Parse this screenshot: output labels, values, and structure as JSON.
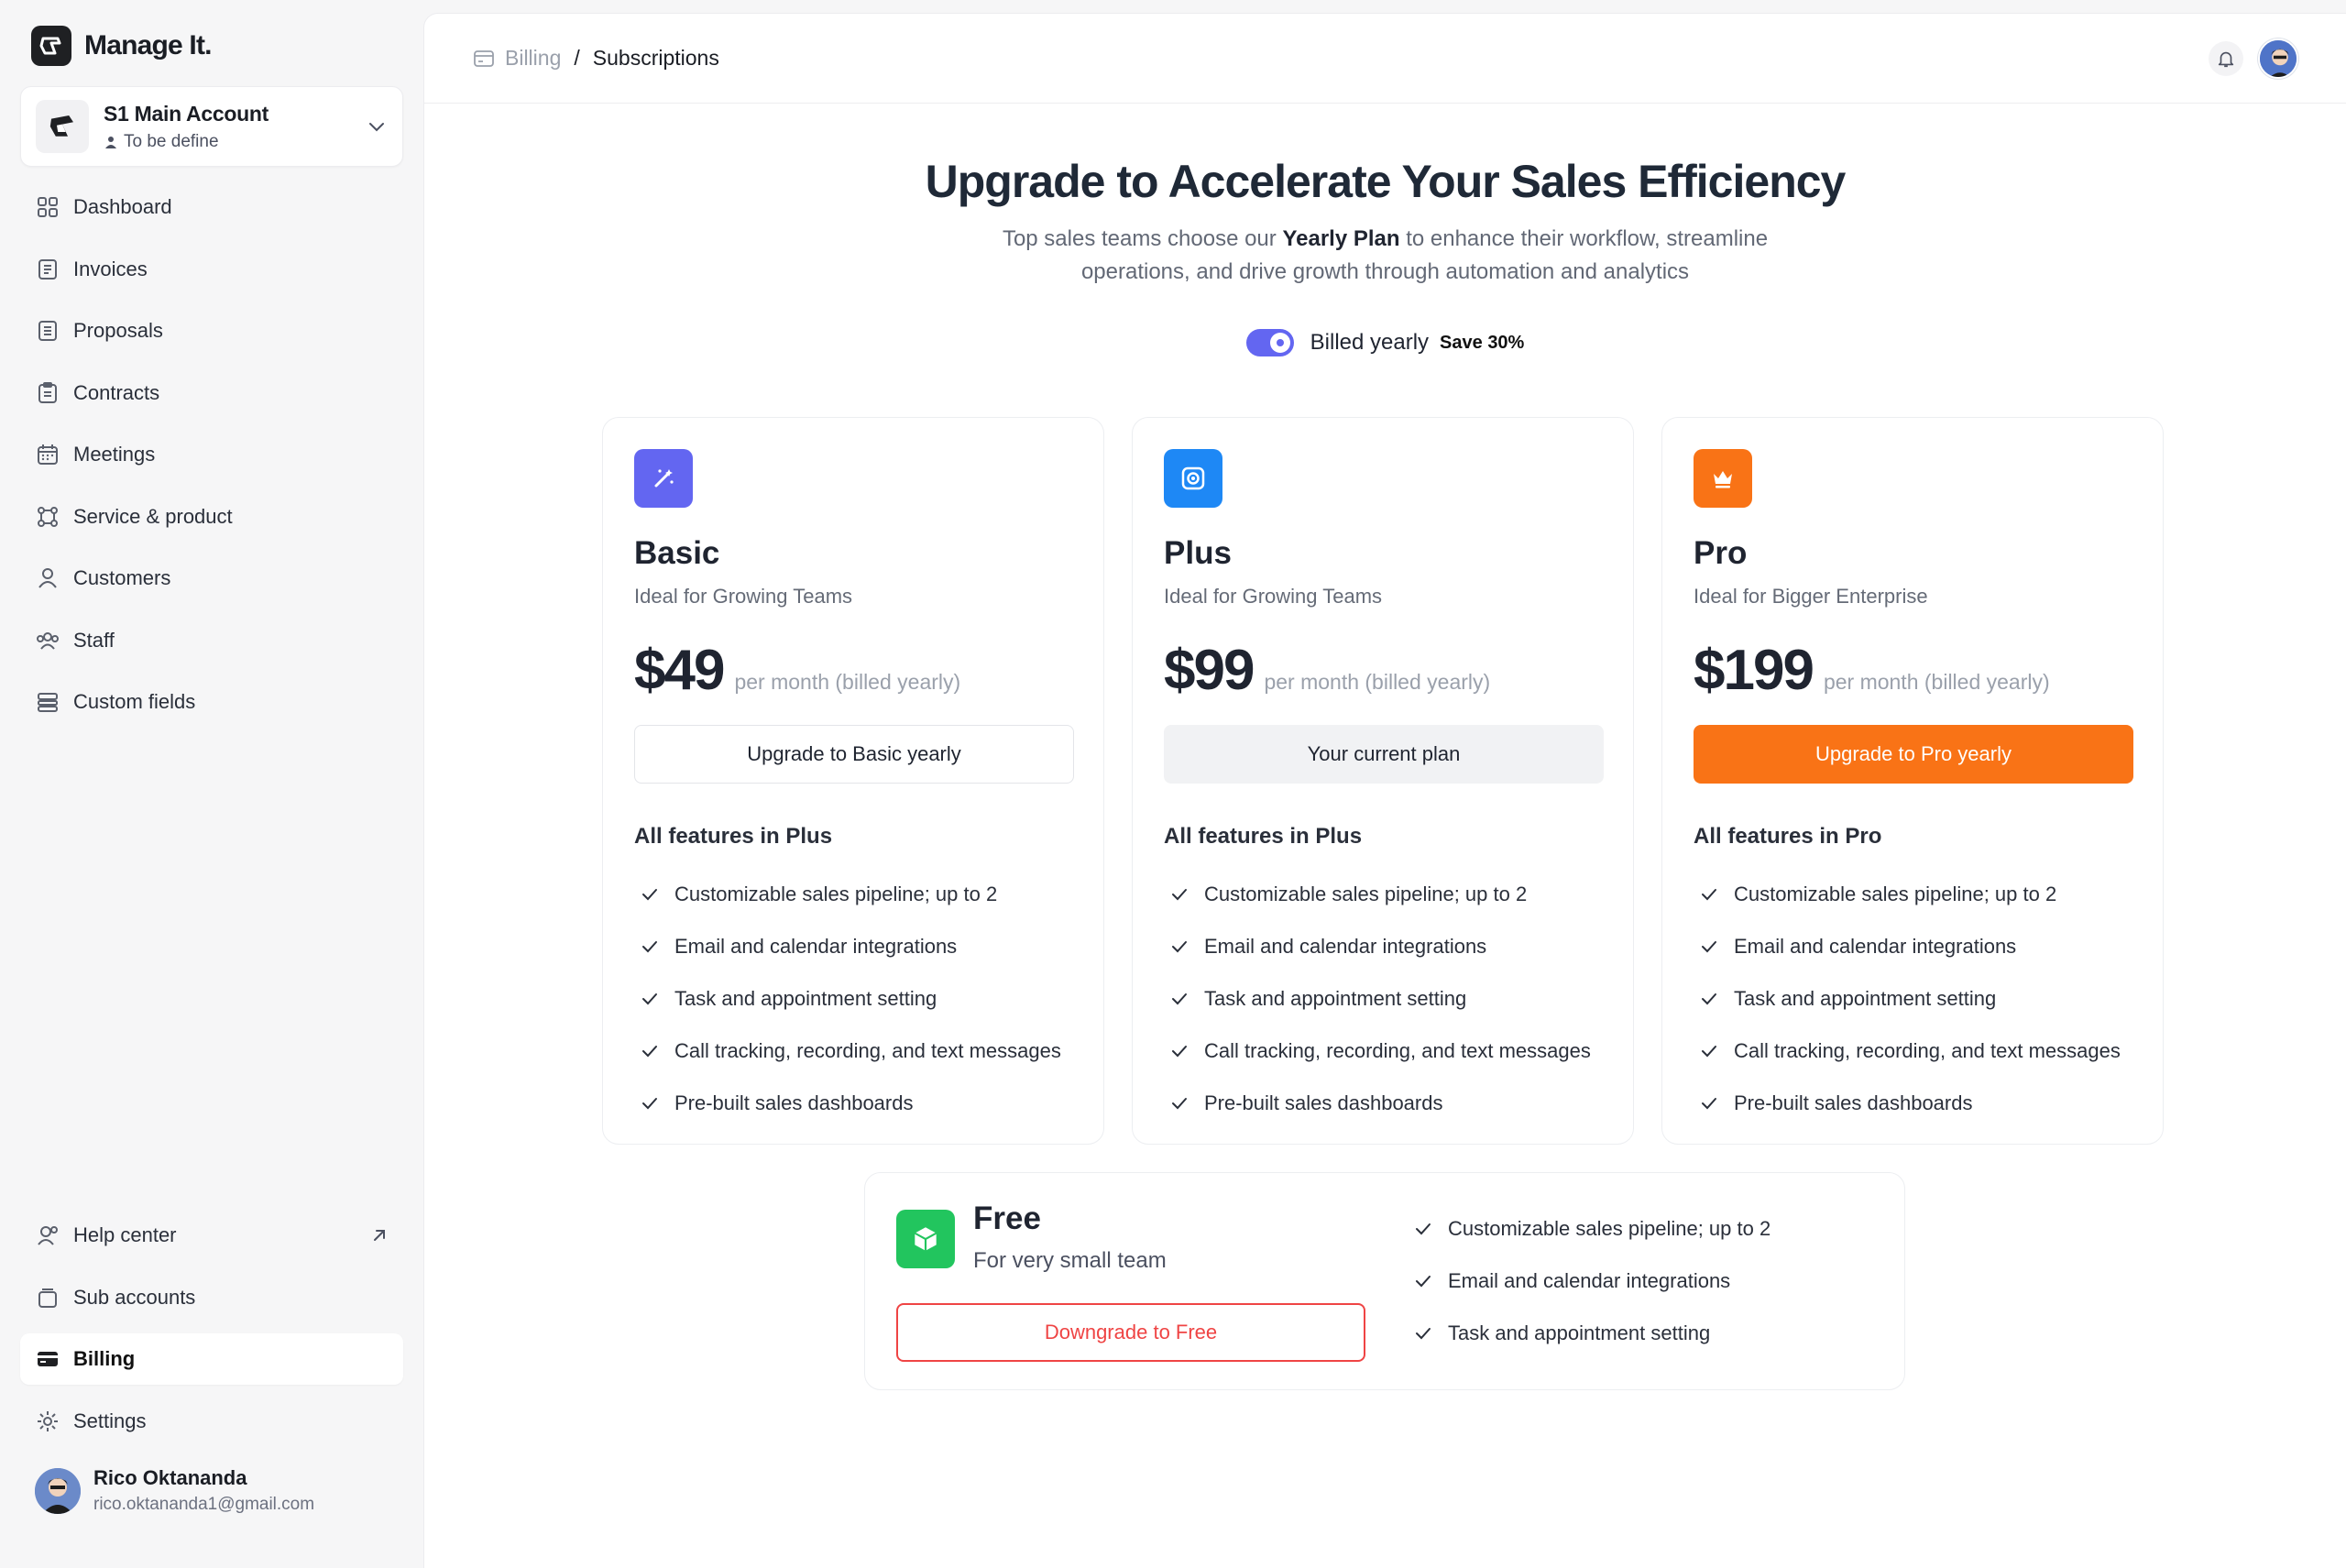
{
  "brand": {
    "name": "Manage It."
  },
  "account": {
    "name": "S1 Main Account",
    "sub": "To be define"
  },
  "nav": [
    {
      "label": "Dashboard",
      "icon": "dashboard-icon"
    },
    {
      "label": "Invoices",
      "icon": "invoice-icon"
    },
    {
      "label": "Proposals",
      "icon": "proposal-icon"
    },
    {
      "label": "Contracts",
      "icon": "contract-icon"
    },
    {
      "label": "Meetings",
      "icon": "calendar-icon"
    },
    {
      "label": "Service & product",
      "icon": "service-icon"
    },
    {
      "label": "Customers",
      "icon": "customer-icon"
    },
    {
      "label": "Staff",
      "icon": "staff-icon"
    },
    {
      "label": "Custom fields",
      "icon": "custom-fields-icon"
    }
  ],
  "bottom_nav": [
    {
      "label": "Help center",
      "icon": "help-icon"
    },
    {
      "label": "Sub accounts",
      "icon": "sub-accounts-icon"
    },
    {
      "label": "Billing",
      "icon": "billing-icon",
      "active": true
    },
    {
      "label": "Settings",
      "icon": "gear-icon"
    }
  ],
  "user": {
    "name": "Rico Oktananda",
    "email": "rico.oktananda1@gmail.com"
  },
  "breadcrumb": {
    "parent": "Billing",
    "separator": "/",
    "current": "Subscriptions"
  },
  "hero": {
    "title": "Upgrade to Accelerate Your Sales Efficiency",
    "subtitle_pre": "Top sales teams choose our ",
    "subtitle_bold": "Yearly Plan",
    "subtitle_post": " to enhance their workflow, streamline operations, and drive growth through automation and analytics"
  },
  "billing_toggle": {
    "label": "Billed yearly",
    "badge": "Save 30%",
    "on": true
  },
  "plans": [
    {
      "name": "Basic",
      "tagline": "Ideal for Growing Teams",
      "price": "$49",
      "per": "per month (billed yearly)",
      "button": "Upgrade to Basic yearly",
      "features_title": "All features in Plus",
      "icon": "magic-wand-icon",
      "color": "#6366f1",
      "features": [
        "Customizable sales pipeline; up to 2",
        "Email and calendar integrations",
        "Task and appointment setting",
        "Call tracking, recording, and text messages",
        "Pre-built sales dashboards"
      ]
    },
    {
      "name": "Plus",
      "tagline": "Ideal for Growing Teams",
      "price": "$99",
      "per": "per month (billed yearly)",
      "button": "Your current plan",
      "features_title": "All features in Plus",
      "icon": "target-icon",
      "color": "#1e88f5",
      "features": [
        "Customizable sales pipeline; up to 2",
        "Email and calendar integrations",
        "Task and appointment setting",
        "Call tracking, recording, and text messages",
        "Pre-built sales dashboards"
      ]
    },
    {
      "name": "Pro",
      "tagline": "Ideal for Bigger Enterprise",
      "price": "$199",
      "per": "per month (billed yearly)",
      "button": "Upgrade to Pro yearly",
      "features_title": "All features in Pro",
      "icon": "crown-icon",
      "color": "#f97316",
      "features": [
        "Customizable sales pipeline; up to 2",
        "Email and calendar integrations",
        "Task and appointment setting",
        "Call tracking, recording, and text messages",
        "Pre-built sales dashboards"
      ]
    }
  ],
  "free_plan": {
    "name": "Free",
    "tagline": "For very small team",
    "button": "Downgrade to Free",
    "icon": "box-icon",
    "color": "#22c55e",
    "features": [
      "Customizable sales pipeline; up to 2",
      "Email and calendar integrations",
      "Task and appointment setting"
    ]
  }
}
